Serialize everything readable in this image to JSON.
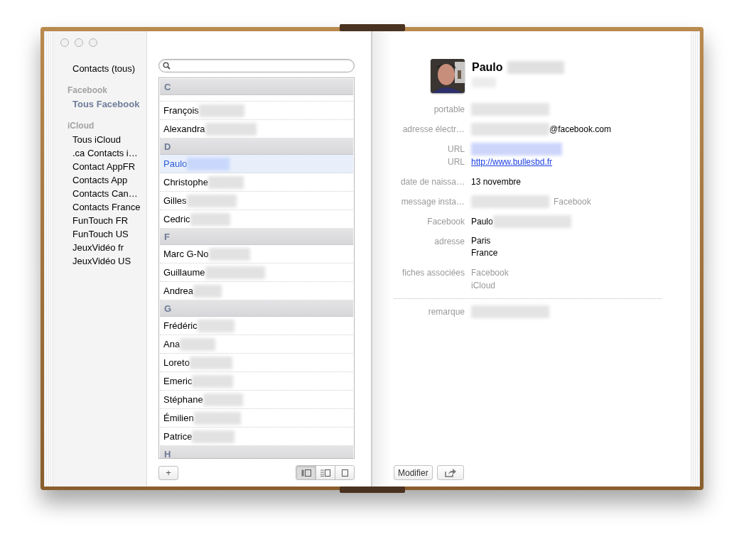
{
  "sidebar": [
    {
      "items": [
        {
          "label": "Contacts (tous)",
          "selected": false
        }
      ]
    },
    {
      "heading": "Facebook",
      "items": [
        {
          "label": "Tous Facebook",
          "selected": true
        }
      ]
    },
    {
      "heading": "iCloud",
      "items": [
        {
          "label": "Tous iCloud",
          "selected": false
        },
        {
          "label": ".ca Contacts i…",
          "selected": false
        },
        {
          "label": "Contact AppFR",
          "selected": false
        },
        {
          "label": "Contacts App",
          "selected": false
        },
        {
          "label": "Contacts Can…",
          "selected": false
        },
        {
          "label": "Contacts France",
          "selected": false
        },
        {
          "label": "FunTouch FR",
          "selected": false
        },
        {
          "label": "FunTouch US",
          "selected": false
        },
        {
          "label": "JeuxVidéo fr",
          "selected": false
        },
        {
          "label": "JeuxVidéo US",
          "selected": false
        }
      ]
    }
  ],
  "list": [
    {
      "letter": "C",
      "rows": [
        {
          "name": "François",
          "selected": false
        },
        {
          "name": "Alexandra",
          "selected": false
        }
      ]
    },
    {
      "letter": "D",
      "rows": [
        {
          "name": "Paulo",
          "selected": true
        },
        {
          "name": "Christophe",
          "selected": false
        },
        {
          "name": "Gilles",
          "selected": false
        },
        {
          "name": "Cedric",
          "selected": false
        }
      ]
    },
    {
      "letter": "F",
      "rows": [
        {
          "name": "Marc G-No",
          "selected": false
        },
        {
          "name": "Guillaume",
          "selected": false
        },
        {
          "name": "Andrea",
          "selected": false
        }
      ]
    },
    {
      "letter": "G",
      "rows": [
        {
          "name": "Frédéric",
          "selected": false
        },
        {
          "name": "Ana",
          "selected": false
        },
        {
          "name": "Loreto",
          "selected": false
        },
        {
          "name": "Emeric",
          "selected": false
        },
        {
          "name": "Stéphane",
          "selected": false
        },
        {
          "name": "Émilien",
          "selected": false
        },
        {
          "name": "Patrice",
          "selected": false
        }
      ]
    },
    {
      "letter": "H"
    }
  ],
  "add_button": "+",
  "view_modes": [
    {
      "selected": true
    },
    {
      "selected": false
    },
    {
      "selected": false
    }
  ],
  "card": {
    "name": "Paulo",
    "fields": [
      {
        "label": "portable",
        "values": [
          {
            "kind": "blurred"
          }
        ]
      },
      {
        "label": "adresse électr…",
        "values": [
          {
            "kind": "blurred"
          },
          {
            "kind": "text",
            "text": "@facebook.com"
          }
        ]
      },
      {
        "label": "URL",
        "values": [
          {
            "kind": "blurred-link"
          }
        ],
        "tight": true
      },
      {
        "label": "URL",
        "values": [
          {
            "kind": "link",
            "text": "http://www.bullesbd.fr"
          }
        ]
      },
      {
        "label": "date de naissa…",
        "values": [
          {
            "kind": "text",
            "text": "13 novembre"
          }
        ]
      },
      {
        "label": "message insta…",
        "values": [
          {
            "kind": "blurred"
          },
          {
            "kind": "muted",
            "text": "Facebook"
          }
        ]
      },
      {
        "label": "Facebook",
        "values": [
          {
            "kind": "text",
            "text": "Paulo"
          },
          {
            "kind": "blurred"
          }
        ]
      },
      {
        "label": "adresse",
        "values": [
          {
            "kind": "line",
            "text": "Paris"
          },
          {
            "kind": "line",
            "text": "France"
          }
        ]
      },
      {
        "label": "fiches associées",
        "values": [
          {
            "kind": "muted-line",
            "text": "Facebook"
          },
          {
            "kind": "muted-line",
            "text": "iCloud"
          }
        ]
      },
      {
        "label": "remarque",
        "values": [
          {
            "kind": "blurred"
          }
        ],
        "divider": true
      }
    ],
    "edit_button": "Modifier"
  }
}
